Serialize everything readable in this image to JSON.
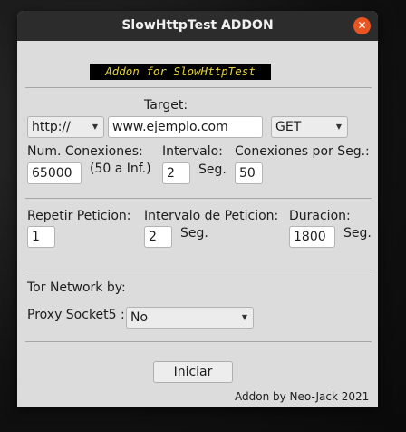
{
  "window": {
    "title": "SlowHttpTest ADDON",
    "close_symbol": "✕",
    "accent_color": "#e95420"
  },
  "banner": {
    "text": "Addon for SlowHttpTest",
    "text_color": "#e6d23a",
    "bg_color": "#000000"
  },
  "target": {
    "label": "Target:",
    "protocol": {
      "value": "http://"
    },
    "url": {
      "value": "www.ejemplo.com"
    },
    "method": {
      "value": "GET"
    }
  },
  "connections": {
    "num_label": "Num. Conexiones:",
    "num_value": "65000",
    "num_hint": "(50 a Inf.)",
    "interval_label": "Intervalo:",
    "interval_value": "2",
    "interval_unit": "Seg.",
    "per_sec_label": "Conexiones por Seg.:",
    "per_sec_value": "50"
  },
  "repeat": {
    "repeat_label": "Repetir Peticion:",
    "repeat_value": "1",
    "interval_label": "Intervalo de Peticion:",
    "interval_value": "2",
    "interval_unit": "Seg.",
    "duration_label": "Duracion:",
    "duration_value": "1800",
    "duration_unit": "Seg."
  },
  "tor": {
    "label": "Tor Network by:",
    "proxy_label": "Proxy Socket5 :",
    "proxy_value": "No"
  },
  "actions": {
    "start_label": "Iniciar"
  },
  "footer": {
    "credit": "Addon by Neo-Jack 2021"
  }
}
